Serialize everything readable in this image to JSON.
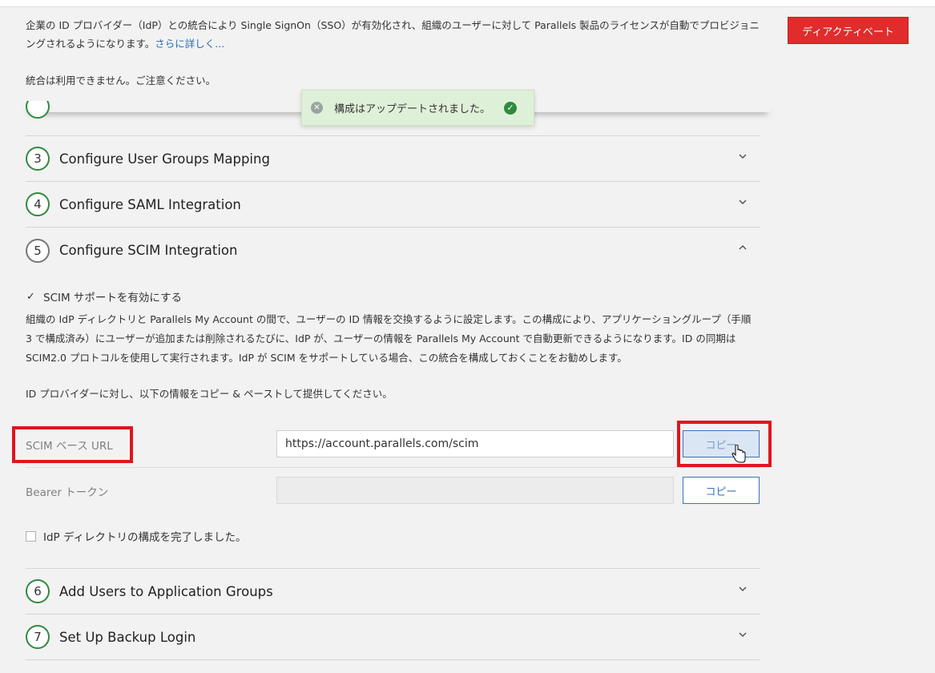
{
  "intro": {
    "text": "企業の ID プロバイダー（IdP）との統合により Single SignOn（SSO）が有効化され、組織のユーザーに対して Parallels 製品のライセンスが自動でプロビジョニングされるようになります。",
    "link": "さらに詳しく..."
  },
  "notice": "統合は利用できません。ご注意ください。",
  "deactivate_label": "ディアクティベート",
  "toast": {
    "message": "構成はアップデートされました。"
  },
  "steps": [
    {
      "number": "3",
      "title": "Configure User Groups Mapping",
      "state": "collapsed"
    },
    {
      "number": "4",
      "title": "Configure SAML Integration",
      "state": "collapsed"
    },
    {
      "number": "5",
      "title": "Configure SCIM Integration",
      "state": "expanded"
    },
    {
      "number": "6",
      "title": "Add Users to Application Groups",
      "state": "collapsed"
    },
    {
      "number": "7",
      "title": "Set Up Backup Login",
      "state": "collapsed"
    }
  ],
  "scim": {
    "enable_label": "SCIM サポートを有効にする",
    "enabled": true,
    "description": "組織の IdP ディレクトリと Parallels My Account の間で、ユーザーの ID 情報を交換するように設定します。この構成により、アプリケーショングループ（手順 3 で構成済み）にユーザーが追加または削除されるたびに、IdP が、ユーザーの情報を Parallels My Account で自動更新できるようになります。ID の同期は SCIM2.0 プロトコルを使用して実行されます。IdP が SCIM をサポートしている場合、この統合を構成しておくことをお勧めします。",
    "instruction": "ID プロバイダーに対し、以下の情報をコピー & ペーストして提供してください。",
    "base_url_label": "SCIM ベース URL",
    "base_url_value": "https://account.parallels.com/scim",
    "token_label": "Bearer トークン",
    "token_value": "",
    "copy_label": "コピー",
    "done_label": "IdP ディレクトリの構成を完了しました。",
    "done_checked": false
  },
  "colors": {
    "accent_green": "#2e8b3e",
    "danger_red": "#e02c2c",
    "link_blue": "#2b6cb0",
    "highlight_red": "#e2141e"
  }
}
